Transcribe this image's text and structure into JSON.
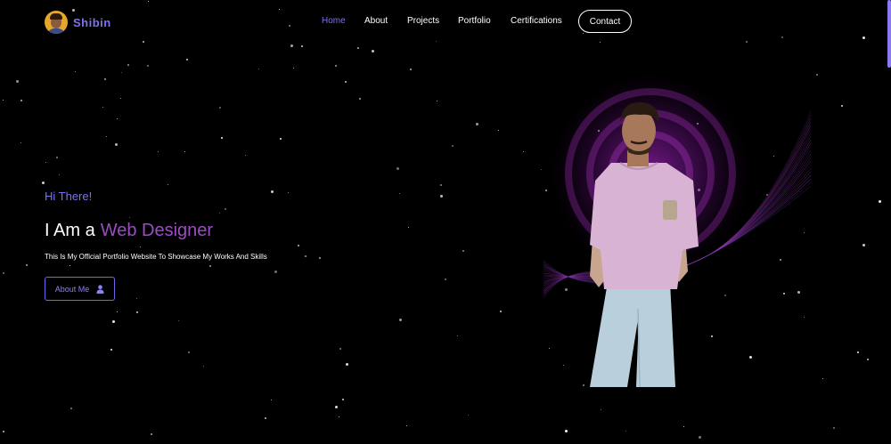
{
  "brand": {
    "name": "Shibin",
    "avatar_icon": "profile-photo"
  },
  "nav": {
    "items": [
      {
        "label": "Home",
        "active": true
      },
      {
        "label": "About",
        "active": false
      },
      {
        "label": "Projects",
        "active": false
      },
      {
        "label": "Portfolio",
        "active": false
      },
      {
        "label": "Certifications",
        "active": false
      }
    ],
    "contact_label": "Contact"
  },
  "hero": {
    "greeting": "Hi There!",
    "headline_static": "I Am a",
    "headline_role": "Web Designer",
    "tagline": "This Is My Official Portfolio Website To Showcase My Works And Skills",
    "about_button": {
      "label": "About Me",
      "icon": "user-icon"
    },
    "portrait_description_icon": "person-photo"
  },
  "colors": {
    "accent": "#7a72f2",
    "role_text": "#9b4cc3",
    "background": "#000000",
    "glow": "#8a1fa0"
  }
}
